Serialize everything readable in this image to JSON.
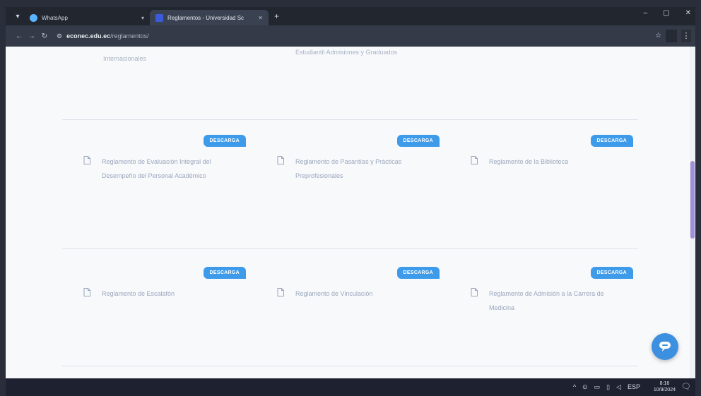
{
  "browser": {
    "tabs": [
      {
        "title": "WhatsApp",
        "active": false
      },
      {
        "title": "Reglamentos - Universidad Sc",
        "active": true
      }
    ],
    "new_tab_symbol": "+",
    "url_site": "econec.edu.ec",
    "url_path": "/reglamentos/",
    "window_controls": [
      "–",
      "▢",
      "✕"
    ]
  },
  "page": {
    "top_fragments": {
      "left": "Internacionales",
      "middle": "Estudiantil Admisiones y Graduados"
    },
    "badge_label": "DESCARGA",
    "rows": [
      {
        "cards": [
          {
            "title": "Reglamento de Evaluación Integral del Desempeño del Personal Académico"
          },
          {
            "title": "Reglamento de Pasantías y Prácticas Preprofesionales"
          },
          {
            "title": "Reglamento de la Biblioteca"
          }
        ]
      },
      {
        "cards": [
          {
            "title": "Reglamento de Escalafón"
          },
          {
            "title": "Reglamento de Vinculación"
          },
          {
            "title": "Reglamento de Admisión a la Carrera de Medicina"
          }
        ]
      }
    ]
  },
  "taskbar": {
    "tray_icons": [
      "^",
      "⊙",
      "▭",
      "▯",
      "◁",
      "ESP"
    ],
    "time": "8:16",
    "date": "10/9/2024"
  },
  "colors": {
    "accent": "#3d9be9",
    "scroll_thumb": "#9e8fd6",
    "link_text": "#9aa7bd"
  }
}
